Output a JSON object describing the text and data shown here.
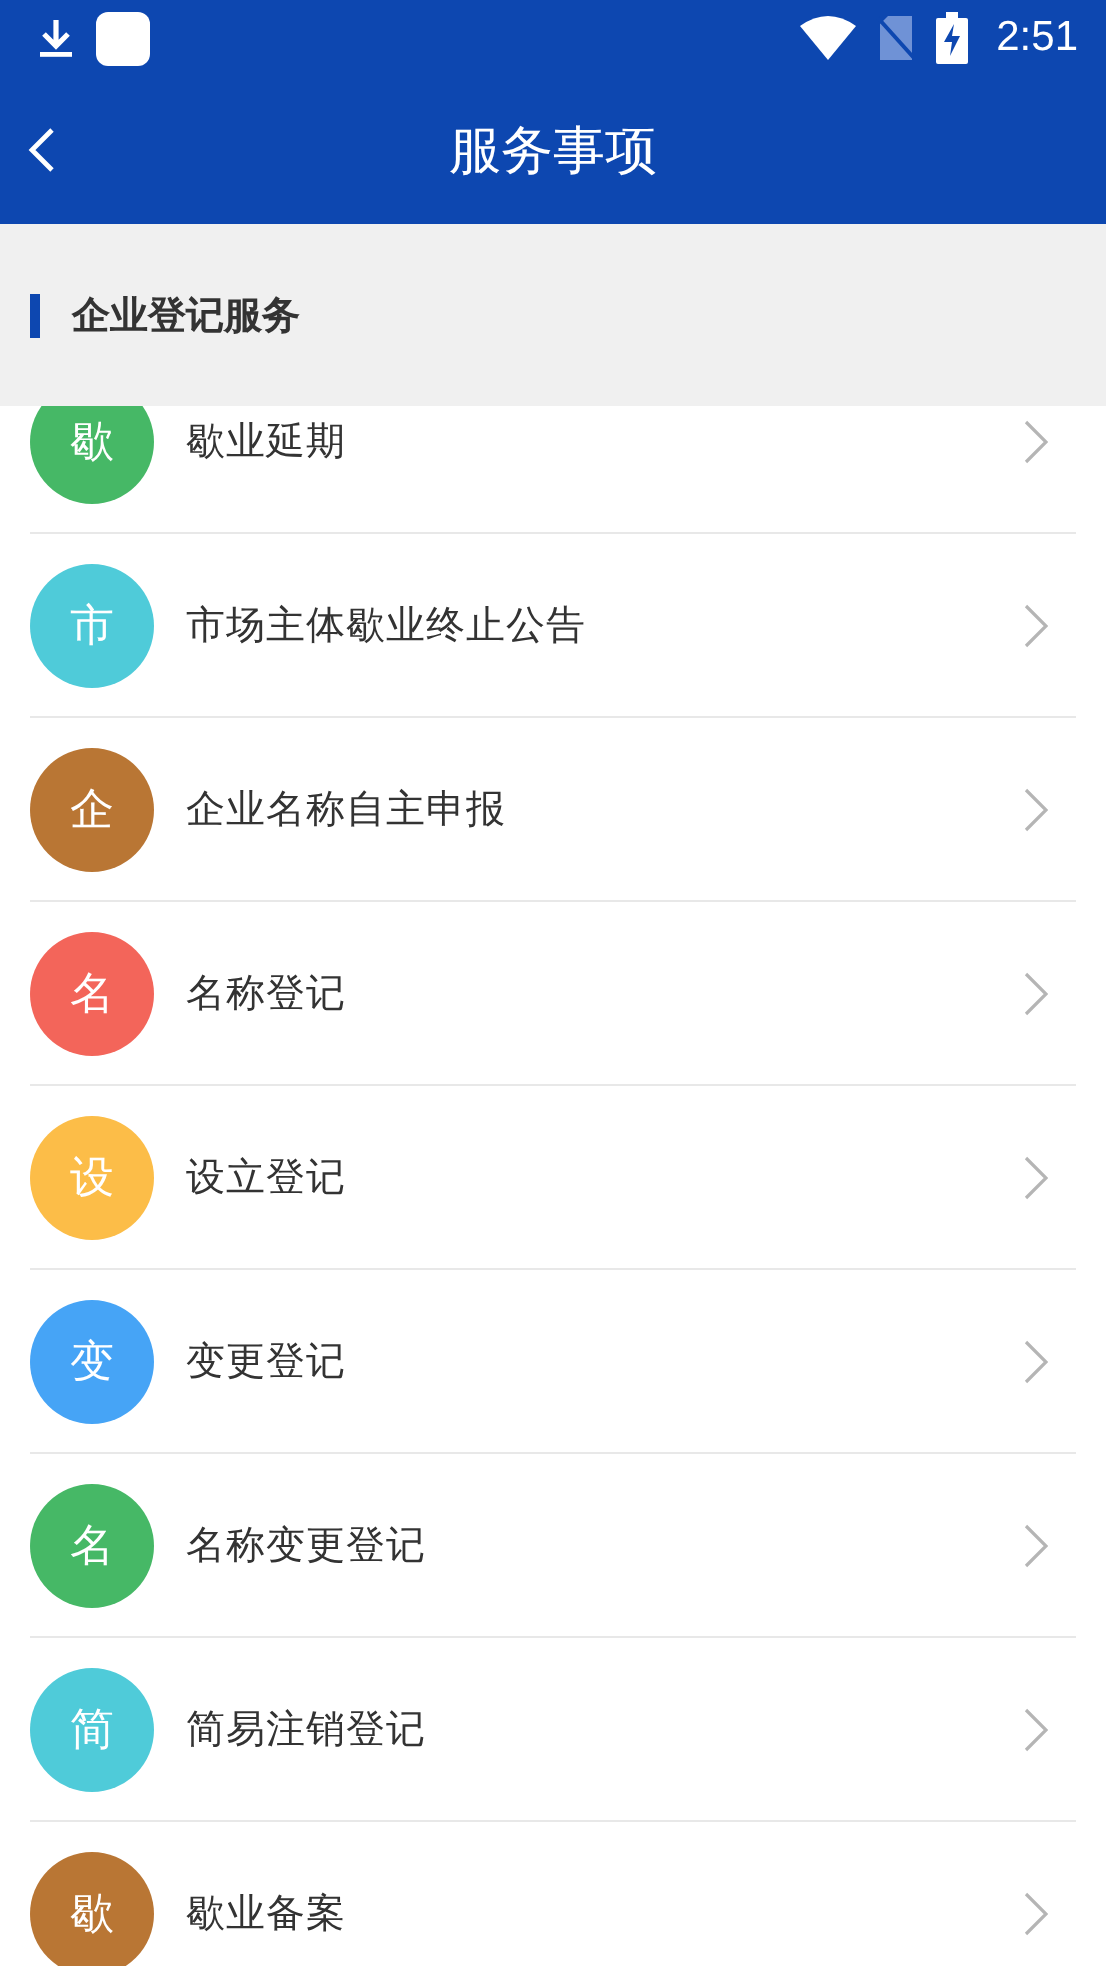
{
  "status_bar": {
    "time": "2:51"
  },
  "app_bar": {
    "title": "服务事项"
  },
  "section": {
    "title": "企业登记服务"
  },
  "items": [
    {
      "avatar": "歇",
      "label": "歇业延期",
      "color": "#46b866"
    },
    {
      "avatar": "市",
      "label": "市场主体歇业终止公告",
      "color": "#4fcbd9"
    },
    {
      "avatar": "企",
      "label": "企业名称自主申报",
      "color": "#b97634"
    },
    {
      "avatar": "名",
      "label": "名称登记",
      "color": "#f3655a"
    },
    {
      "avatar": "设",
      "label": "设立登记",
      "color": "#fcbd48"
    },
    {
      "avatar": "变",
      "label": "变更登记",
      "color": "#46a4f6"
    },
    {
      "avatar": "名",
      "label": "名称变更登记",
      "color": "#46b866"
    },
    {
      "avatar": "简",
      "label": "简易注销登记",
      "color": "#4fcbd9"
    },
    {
      "avatar": "歇",
      "label": "歇业备案",
      "color": "#b97634"
    }
  ]
}
